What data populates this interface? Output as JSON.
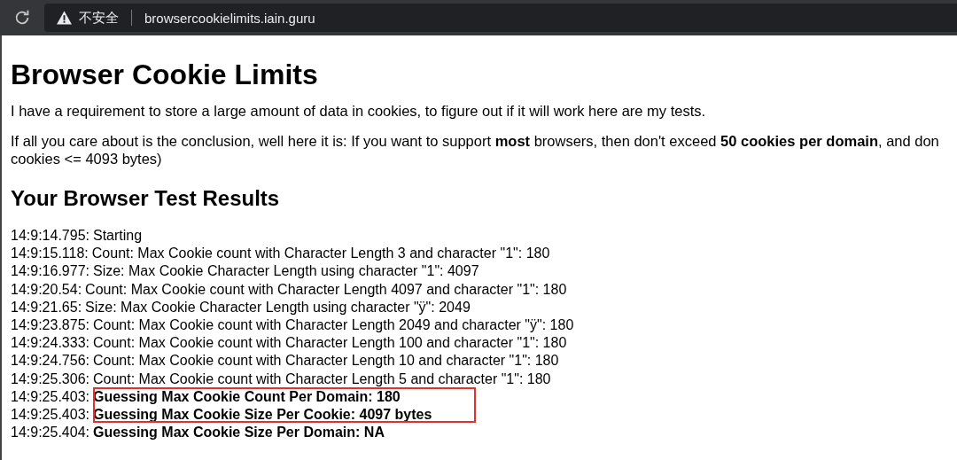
{
  "browser": {
    "security_label": "不安全",
    "url": "browsercookielimits.iain.guru"
  },
  "page": {
    "title": "Browser Cookie Limits",
    "intro": "I have a requirement to store a large amount of data in cookies, to figure out if it will work here are my tests.",
    "conclusion_lines": [
      "If all you care about is the conclusion, well here it is: If you want to support **most** browsers, then don't exceed **50 cookies per domain**, and don",
      "cookies <= 4093 bytes)"
    ],
    "results_heading": "Your Browser Test Results",
    "log": [
      {
        "time": "14:9:14.795:",
        "message": "Starting",
        "bold": false,
        "highlighted": false
      },
      {
        "time": "14:9:15.118:",
        "message": "Count: Max Cookie count with Character Length 3 and character \"1\": 180",
        "bold": false,
        "highlighted": false
      },
      {
        "time": "14:9:16.977:",
        "message": "Size: Max Cookie Character Length using character \"1\": 4097",
        "bold": false,
        "highlighted": false
      },
      {
        "time": "14:9:20.54:",
        "message": "Count: Max Cookie count with Character Length 4097 and character \"1\": 180",
        "bold": false,
        "highlighted": false
      },
      {
        "time": "14:9:21.65:",
        "message": "Size: Max Cookie Character Length using character \"ÿ\": 2049",
        "bold": false,
        "highlighted": false
      },
      {
        "time": "14:9:23.875:",
        "message": "Count: Max Cookie count with Character Length 2049 and character \"ÿ\": 180",
        "bold": false,
        "highlighted": false
      },
      {
        "time": "14:9:24.333:",
        "message": "Count: Max Cookie count with Character Length 100 and character \"1\": 180",
        "bold": false,
        "highlighted": false
      },
      {
        "time": "14:9:24.756:",
        "message": "Count: Max Cookie count with Character Length 10 and character \"1\": 180",
        "bold": false,
        "highlighted": false
      },
      {
        "time": "14:9:25.306:",
        "message": "Count: Max Cookie count with Character Length 5 and character \"1\": 180",
        "bold": false,
        "highlighted": false
      },
      {
        "time": "14:9:25.403:",
        "message": "Guessing Max Cookie Count Per Domain: 180",
        "bold": true,
        "highlighted": true
      },
      {
        "time": "14:9:25.403:",
        "message": "Guessing Max Cookie Size Per Cookie: 4097 bytes",
        "bold": true,
        "highlighted": true
      },
      {
        "time": "14:9:25.404:",
        "message": "Guessing Max Cookie Size Per Domain: NA",
        "bold": true,
        "highlighted": false
      }
    ]
  }
}
